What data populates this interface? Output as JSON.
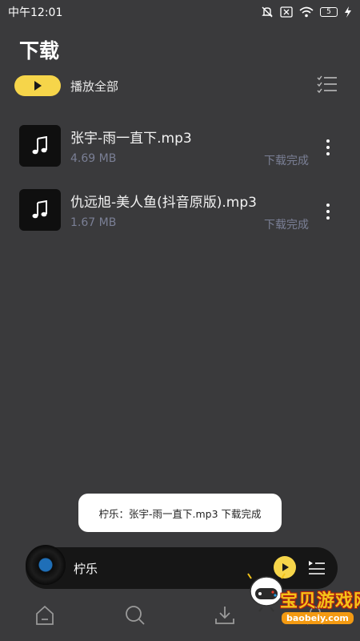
{
  "status_bar": {
    "time": "中午12:01",
    "battery": "5"
  },
  "header": {
    "title": "下载",
    "play_all_label": "播放全部"
  },
  "songs": [
    {
      "title": "张宇-雨一直下.mp3",
      "size": "4.69 MB",
      "status": "下载完成"
    },
    {
      "title": "仇远旭-美人鱼(抖音原版).mp3",
      "size": "1.67 MB",
      "status": "下载完成"
    }
  ],
  "toast": {
    "text": "柠乐：张宇-雨一直下.mp3 下载完成"
  },
  "mini_player": {
    "title": "柠乐"
  },
  "watermark": {
    "text": "宝贝游戏网",
    "url": "baobeiy.com"
  },
  "colors": {
    "background": "#3a3a3c",
    "accent": "#f6d54a",
    "muted_text": "#7a7f95"
  },
  "icons": [
    "play-icon",
    "checklist-icon",
    "music-note-icon",
    "more-vertical-icon",
    "home-icon",
    "search-icon",
    "download-icon",
    "user-icon",
    "playlist-icon"
  ]
}
